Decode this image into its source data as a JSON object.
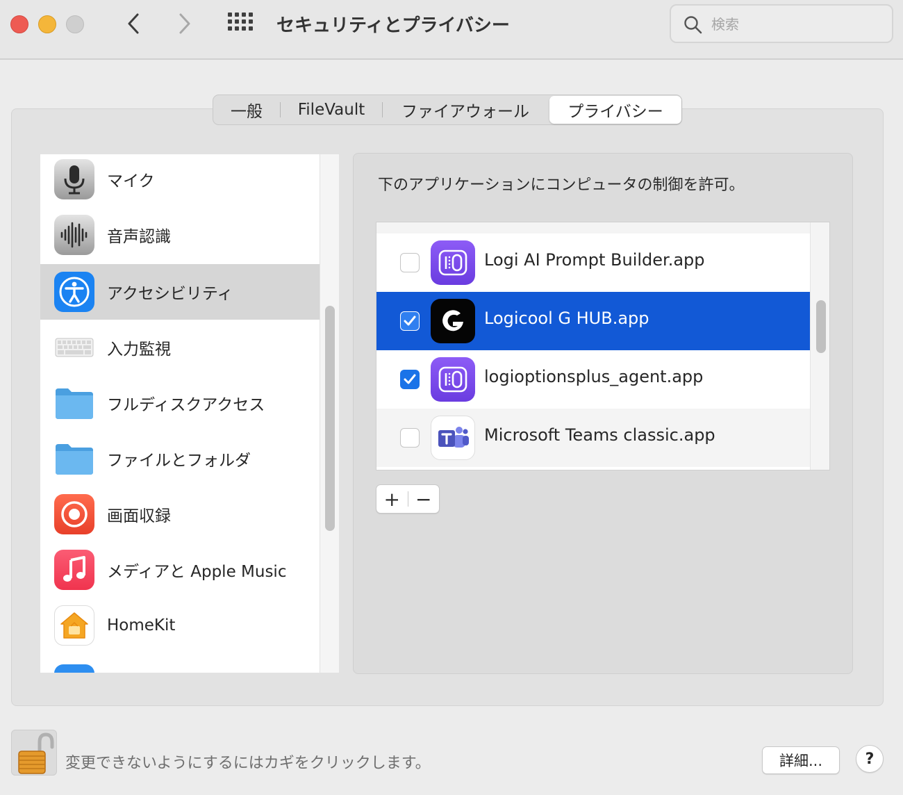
{
  "window": {
    "title": "セキュリティとプライバシー",
    "search_placeholder": "検索"
  },
  "tabs": [
    {
      "label": "一般"
    },
    {
      "label": "FileVault"
    },
    {
      "label": "ファイアウォール"
    },
    {
      "label": "プライバシー",
      "selected": true
    }
  ],
  "sidebar": {
    "items": [
      {
        "label": "マイク",
        "icon": "microphone-icon"
      },
      {
        "label": "音声認識",
        "icon": "speech-recognition-icon"
      },
      {
        "label": "アクセシビリティ",
        "icon": "accessibility-icon",
        "selected": true
      },
      {
        "label": "入力監視",
        "icon": "keyboard-icon"
      },
      {
        "label": "フルディスクアクセス",
        "icon": "folder-icon"
      },
      {
        "label": "ファイルとフォルダ",
        "icon": "folder-icon"
      },
      {
        "label": "画面収録",
        "icon": "screen-recording-icon"
      },
      {
        "label": "メディアと Apple Music",
        "icon": "music-icon"
      },
      {
        "label": "HomeKit",
        "icon": "home-icon"
      }
    ]
  },
  "right": {
    "description": "下のアプリケーションにコンピュータの制御を許可。",
    "apps": [
      {
        "name": "Logi AI Prompt Builder.app",
        "checked": false,
        "icon": "logi-options-icon"
      },
      {
        "name": "Logicool G HUB.app",
        "checked": true,
        "selected": true,
        "icon": "logitech-g-icon"
      },
      {
        "name": "logioptionsplus_agent.app",
        "checked": true,
        "icon": "logi-options-icon"
      },
      {
        "name": "Microsoft Teams classic.app",
        "checked": false,
        "icon": "teams-icon"
      }
    ],
    "add_label": "+",
    "remove_label": "−"
  },
  "footer": {
    "lock_text": "変更できないようにするにはカギをクリックします。",
    "advanced_label": "詳細...",
    "help_label": "?"
  },
  "colors": {
    "selection_blue": "#1259d6",
    "checkbox_blue": "#1a73e8",
    "close_red": "#ee5b53",
    "minimize_yellow": "#f4b63a"
  }
}
